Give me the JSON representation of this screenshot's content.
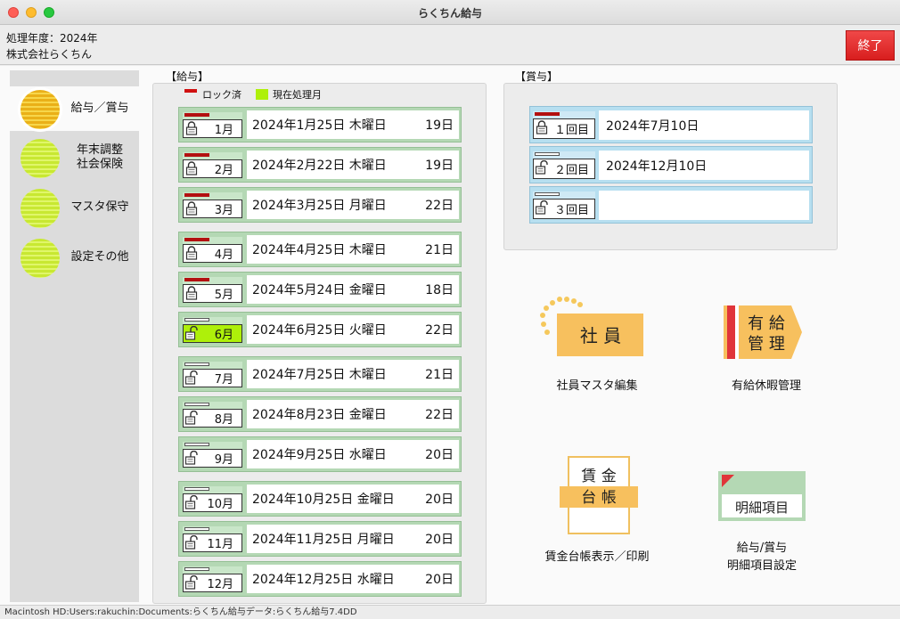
{
  "window": {
    "title": "らくちん給与"
  },
  "info": {
    "year": "処理年度：2024年",
    "company": "株式会社らくちん"
  },
  "exit_label": "終了",
  "sidebar": {
    "items": [
      {
        "label": "給与／賞与",
        "active": true
      },
      {
        "label": "年末調整\n社会保険",
        "active": false
      },
      {
        "label": "マスタ保守",
        "active": false
      },
      {
        "label": "設定その他",
        "active": false
      }
    ]
  },
  "salary": {
    "section_label": "【給与】",
    "legend": {
      "locked": "ロック済",
      "current": "現在処理月"
    },
    "months": [
      {
        "label": "1月",
        "date": "2024年1月25日 木曜日",
        "days": "19日",
        "state": "locked"
      },
      {
        "label": "2月",
        "date": "2024年2月22日 木曜日",
        "days": "19日",
        "state": "locked"
      },
      {
        "label": "3月",
        "date": "2024年3月25日 月曜日",
        "days": "22日",
        "state": "locked"
      },
      {
        "label": "4月",
        "date": "2024年4月25日 木曜日",
        "days": "21日",
        "state": "locked"
      },
      {
        "label": "5月",
        "date": "2024年5月24日 金曜日",
        "days": "18日",
        "state": "locked"
      },
      {
        "label": "6月",
        "date": "2024年6月25日 火曜日",
        "days": "22日",
        "state": "current"
      },
      {
        "label": "7月",
        "date": "2024年7月25日 木曜日",
        "days": "21日",
        "state": "open"
      },
      {
        "label": "8月",
        "date": "2024年8月23日 金曜日",
        "days": "22日",
        "state": "open"
      },
      {
        "label": "9月",
        "date": "2024年9月25日 水曜日",
        "days": "20日",
        "state": "open"
      },
      {
        "label": "10月",
        "date": "2024年10月25日 金曜日",
        "days": "20日",
        "state": "open"
      },
      {
        "label": "11月",
        "date": "2024年11月25日 月曜日",
        "days": "20日",
        "state": "open"
      },
      {
        "label": "12月",
        "date": "2024年12月25日 水曜日",
        "days": "20日",
        "state": "open"
      }
    ]
  },
  "bonus": {
    "section_label": "【賞与】",
    "rounds": [
      {
        "label": "１回目",
        "date": "2024年7月10日",
        "state": "locked"
      },
      {
        "label": "２回目",
        "date": "2024年12月10日",
        "state": "open"
      },
      {
        "label": "３回目",
        "date": "",
        "state": "open"
      }
    ]
  },
  "functions": {
    "employee": {
      "icon_text": "社 員",
      "caption": "社員マスタ編集"
    },
    "paid_leave": {
      "icon_text_1": "有 給",
      "icon_text_2": "管 理",
      "caption": "有給休暇管理"
    },
    "ledger": {
      "icon_text_1": "賃 金",
      "icon_text_2": "台 帳",
      "caption": "賃金台帳表示／印刷"
    },
    "items": {
      "icon_text": "明細項目",
      "caption_1": "給与/賞与",
      "caption_2": "明細項目設定"
    }
  },
  "status_path": "Macintosh HD:Users:rakuchin:Documents:らくちん給与データ:らくちん給与7.4DD",
  "colors": {
    "accent_exit": "#e12a2a",
    "lock_red": "#b31010",
    "current_green": "#aef00a",
    "salary_row": "#b4d8b4",
    "bonus_row": "#b7dff0"
  }
}
